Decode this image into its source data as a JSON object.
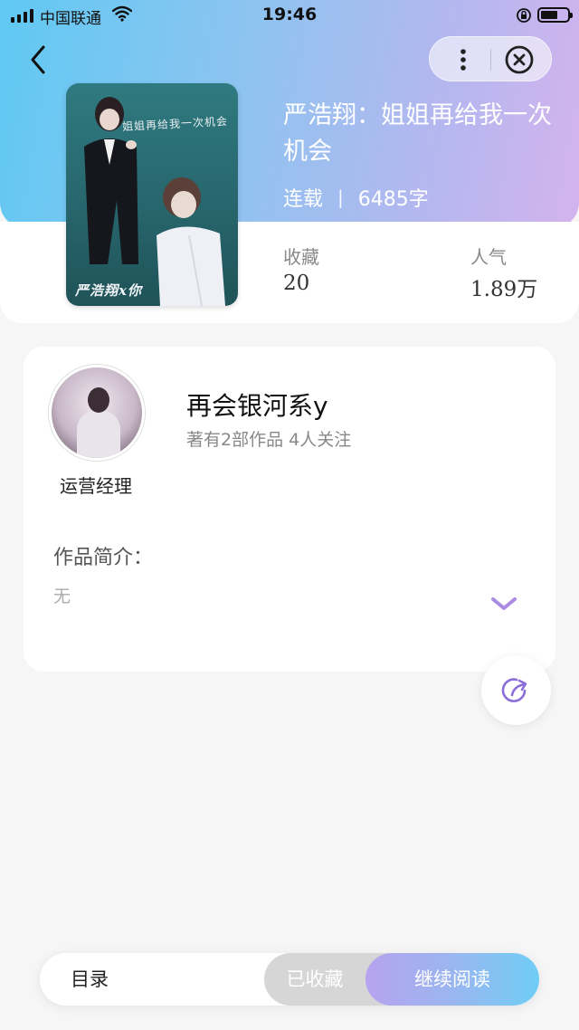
{
  "status_bar": {
    "carrier": "中国联通",
    "time": "19:46"
  },
  "nav": {
    "back_icon": "chevron-left-icon",
    "more_icon": "more-vertical-icon",
    "close_icon": "close-circle-icon"
  },
  "book": {
    "title": "严浩翔：姐姐再给我一次机会",
    "status": "连载",
    "separator": "|",
    "word_count": "6485字",
    "cover": {
      "title_text": "姐姐再给我一次机会",
      "caption_text": "严浩翔x你"
    }
  },
  "stats": {
    "favorites_label": "收藏",
    "favorites_value": "20",
    "popularity_label": "人气",
    "popularity_value": "1.89万"
  },
  "author": {
    "role": "运营经理",
    "name": "再会银河系y",
    "works_follow": "著有2部作品 4人关注"
  },
  "intro": {
    "heading": "作品简介：",
    "body": "无"
  },
  "bottom_bar": {
    "toc_label": "目录",
    "collected_label": "已收藏",
    "continue_label": "继续阅读"
  },
  "colors": {
    "header_gradient_start": "#5fc9f3",
    "header_gradient_end": "#d4b3ee",
    "accent_purple": "#a98be3",
    "collected_bg": "#d6d6d6"
  }
}
